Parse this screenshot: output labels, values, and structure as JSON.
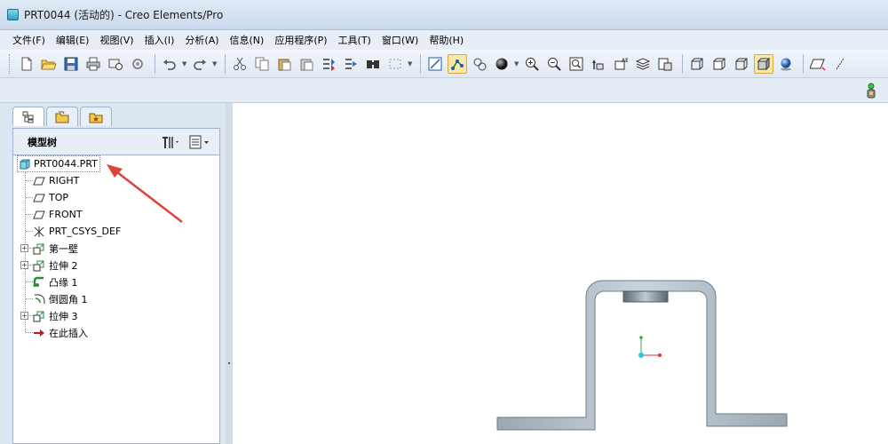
{
  "window": {
    "title": "PRT0044 (活动的) - Creo Elements/Pro"
  },
  "menu": [
    "文件(F)",
    "编辑(E)",
    "视图(V)",
    "插入(I)",
    "分析(A)",
    "信息(N)",
    "应用程序(P)",
    "工具(T)",
    "窗口(W)",
    "帮助(H)"
  ],
  "toolbar": {
    "icons": [
      "new-file-icon",
      "open-folder-icon",
      "save-icon",
      "print-icon",
      "send-mail-icon",
      "sync-icon",
      "undo-icon",
      "redo-icon",
      "cut-icon",
      "copy-icon",
      "paste-icon",
      "paste-special-icon",
      "regenerate-icon",
      "regen-manager-icon",
      "find-icon",
      "select-box-icon",
      "repaint-icon",
      "datum-display-icon",
      "spin-center-icon",
      "shading-icon",
      "zoom-in-icon",
      "zoom-out-icon",
      "refit-icon",
      "reorient-icon",
      "saved-views-icon",
      "layers-icon",
      "view-manager-icon",
      "wireframe-icon",
      "hidden-line-icon",
      "no-hidden-icon",
      "shaded-icon",
      "enhanced-realism-icon",
      "datum-planes-icon"
    ]
  },
  "model_tree": {
    "title": "模型树",
    "root": "PRT0044.PRT",
    "items": [
      {
        "label": "RIGHT",
        "icon": "datum-plane-icon",
        "expandable": false
      },
      {
        "label": "TOP",
        "icon": "datum-plane-icon",
        "expandable": false
      },
      {
        "label": "FRONT",
        "icon": "datum-plane-icon",
        "expandable": false
      },
      {
        "label": "PRT_CSYS_DEF",
        "icon": "csys-icon",
        "expandable": false
      },
      {
        "label": "第一壁",
        "icon": "extrude-feature-icon",
        "expandable": true
      },
      {
        "label": "拉伸 2",
        "icon": "extrude-feature-icon",
        "expandable": true
      },
      {
        "label": "凸缘 1",
        "icon": "flange-icon",
        "expandable": false
      },
      {
        "label": "倒圆角 1",
        "icon": "round-icon",
        "expandable": false
      },
      {
        "label": "拉伸 3",
        "icon": "extrude-feature-icon",
        "expandable": true
      },
      {
        "label": "在此插入",
        "icon": "insert-here-arrow-icon",
        "expandable": false
      }
    ]
  },
  "colors": {
    "accent_annotation": "#e0403a",
    "part_fill": "#b9c5cf",
    "part_edge": "#4d5b66",
    "csys_x": "#e03030",
    "csys_y": "#30b030",
    "csys_origin": "#30c8d8"
  }
}
